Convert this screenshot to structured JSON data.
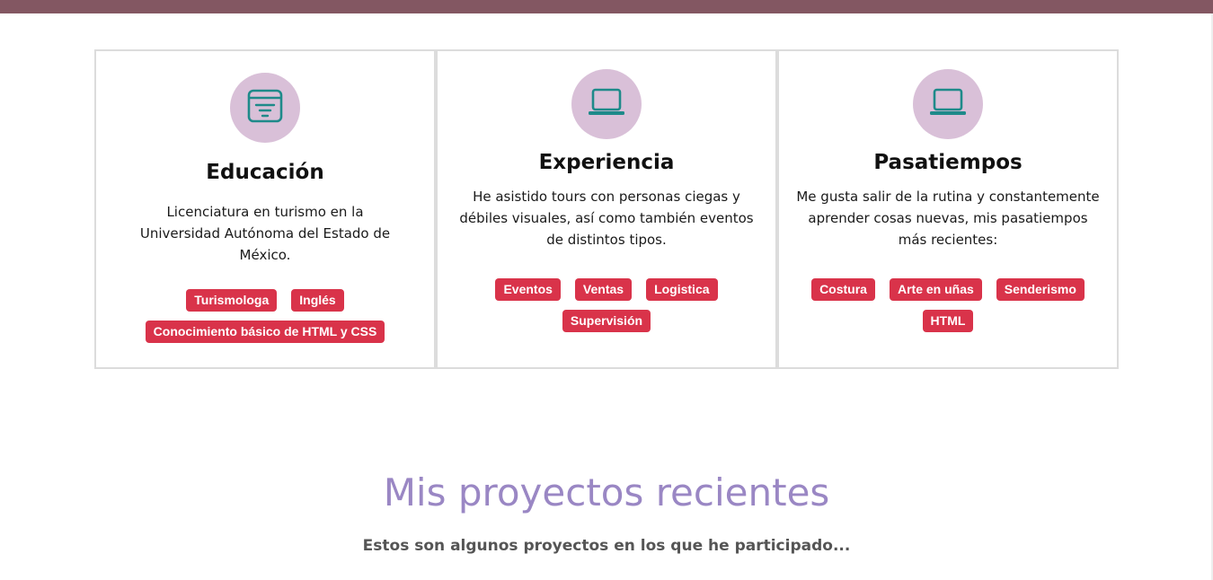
{
  "cards": [
    {
      "icon": "filter-list-icon",
      "title": "Educación",
      "description": "Licenciatura en turismo en la Universidad Autónoma del Estado de México.",
      "tags": [
        "Turismologa",
        "Inglés",
        "Conocimiento básico de HTML y CSS"
      ]
    },
    {
      "icon": "laptop-icon",
      "title": "Experiencia",
      "description": "He asistido tours con personas ciegas y débiles visuales, así como también eventos de distintos tipos.",
      "tags": [
        "Eventos",
        "Ventas",
        "Logistica",
        "Supervisión"
      ]
    },
    {
      "icon": "laptop-icon",
      "title": "Pasatiempos",
      "description": "Me gusta salir de la rutina y constantemente aprender cosas nuevas, mis pasatiempos más recientes:",
      "tags": [
        "Costura",
        "Arte en uñas",
        "Senderismo",
        "HTML"
      ]
    }
  ],
  "projects": {
    "title": "Mis proyectos recientes",
    "subtitle": "Estos son algunos proyectos en los que he participado..."
  },
  "colors": {
    "topbar": "#835762",
    "icon_circle": "#d9c0d8",
    "icon_stroke": "#1e8a8a",
    "tag": "#d9334a",
    "section_title": "#9a87c4"
  }
}
